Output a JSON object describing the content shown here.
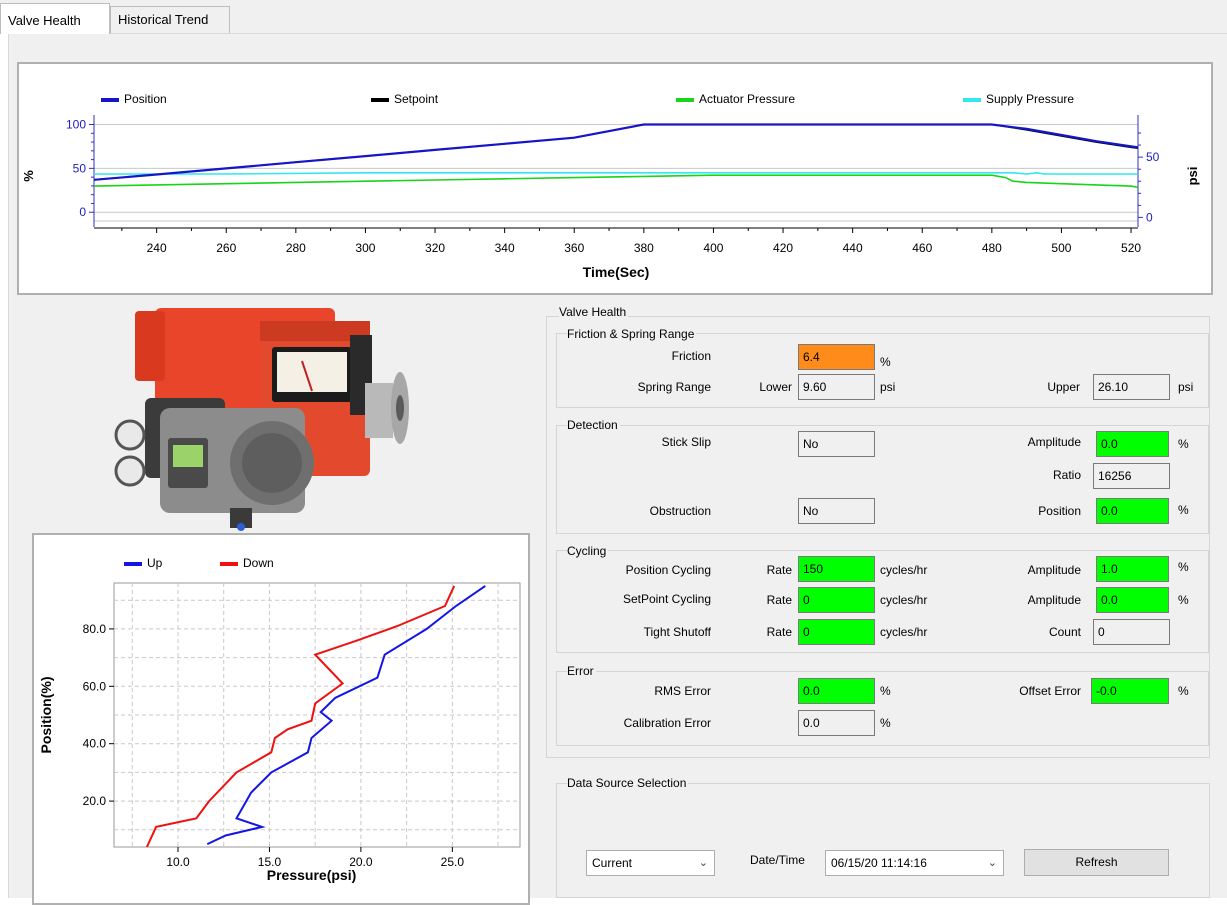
{
  "tabs": [
    {
      "label": "Valve Health",
      "active": true
    },
    {
      "label": "Historical Trend",
      "active": false
    }
  ],
  "trend": {
    "legend": [
      {
        "name": "Position",
        "color": "#1616c8"
      },
      {
        "name": "Setpoint",
        "color": "#000000"
      },
      {
        "name": "Actuator Pressure",
        "color": "#19d419"
      },
      {
        "name": "Supply Pressure",
        "color": "#33e6f0"
      }
    ],
    "ylabel_left": "%",
    "ylabel_right": "psi",
    "xlabel": "Time(Sec)",
    "left_ticks": [
      "100",
      "50",
      "0"
    ],
    "right_ticks": [
      "50",
      "0"
    ],
    "x_ticks": [
      "240",
      "260",
      "280",
      "300",
      "320",
      "340",
      "360",
      "380",
      "400",
      "420",
      "440",
      "460",
      "480",
      "500",
      "520"
    ]
  },
  "pressure_plot": {
    "legend": [
      {
        "name": "Up",
        "color": "#1414e6"
      },
      {
        "name": "Down",
        "color": "#ee1111"
      }
    ],
    "xlabel": "Pressure(psi)",
    "ylabel": "Position(%)",
    "x_ticks": [
      "10.0",
      "15.0",
      "20.0",
      "25.0"
    ],
    "y_ticks": [
      "80.0",
      "60.0",
      "40.0",
      "20.0"
    ]
  },
  "chart_data": [
    {
      "type": "line",
      "xlabel": "Time(Sec)",
      "ylabel": "%",
      "y2label": "psi",
      "xlim": [
        222,
        522
      ],
      "ylim": [
        -10,
        104
      ],
      "y2lim": [
        -3,
        80
      ],
      "grid": true,
      "legend": "top",
      "series": [
        {
          "name": "Position",
          "axis": "left",
          "x": [
            222,
            240,
            260,
            280,
            300,
            320,
            340,
            360,
            380,
            400,
            420,
            440,
            460,
            480,
            490,
            500,
            510,
            520,
            522
          ],
          "y": [
            37,
            43,
            50,
            57,
            64,
            71,
            78,
            85,
            100,
            100,
            100,
            100,
            100,
            100,
            95,
            88,
            81,
            75,
            74
          ]
        },
        {
          "name": "Setpoint",
          "axis": "left",
          "x": [
            222,
            240,
            260,
            280,
            300,
            320,
            340,
            360,
            380,
            400,
            420,
            440,
            460,
            480,
            490,
            500,
            510,
            520,
            522
          ],
          "y": [
            37,
            43,
            50,
            57,
            64,
            71,
            78,
            85,
            100,
            100,
            100,
            100,
            100,
            100,
            94,
            87,
            80,
            74,
            73
          ]
        },
        {
          "name": "Actuator Pressure",
          "axis": "right",
          "x": [
            222,
            240,
            260,
            280,
            300,
            320,
            340,
            360,
            380,
            400,
            420,
            440,
            460,
            480,
            484,
            486,
            490,
            500,
            510,
            520,
            522
          ],
          "y": [
            26,
            27,
            28,
            29,
            30,
            31,
            32,
            33,
            34,
            35,
            35,
            35,
            35,
            35,
            33,
            30,
            29,
            28,
            27,
            26,
            25
          ]
        },
        {
          "name": "Supply Pressure",
          "axis": "right",
          "x": [
            222,
            260,
            300,
            340,
            380,
            420,
            460,
            482,
            486,
            490,
            493,
            495,
            498,
            510,
            522
          ],
          "y": [
            36,
            36,
            37,
            37,
            37,
            37,
            37,
            37,
            37,
            36,
            37,
            36,
            36,
            36,
            36
          ]
        }
      ]
    },
    {
      "type": "line",
      "xlabel": "Pressure(psi)",
      "ylabel": "Position(%)",
      "xlim": [
        6.5,
        28.7
      ],
      "ylim": [
        4,
        96
      ],
      "grid": true,
      "legend": "top",
      "series": [
        {
          "name": "Up",
          "x": [
            11.6,
            12.6,
            14.6,
            13.2,
            14.0,
            15.1,
            17.1,
            17.3,
            18.4,
            17.8,
            18.6,
            20.9,
            21.3,
            23.6,
            25.2,
            26.8
          ],
          "y": [
            5,
            8,
            11,
            14,
            23,
            30,
            37,
            42,
            48,
            51,
            56,
            63,
            71,
            80,
            88,
            95
          ]
        },
        {
          "name": "Down",
          "x": [
            8.3,
            8.8,
            11.0,
            11.7,
            13.2,
            15.1,
            15.3,
            16.0,
            17.3,
            17.5,
            19.0,
            17.5,
            19.8,
            22.0,
            24.6,
            25.1
          ],
          "y": [
            4,
            11,
            14,
            20,
            30,
            37,
            42,
            45,
            48,
            54,
            61,
            71,
            76,
            81,
            88,
            95
          ]
        }
      ]
    }
  ],
  "valve_health": {
    "title": "Valve Health",
    "friction_spring": {
      "title": "Friction & Spring Range",
      "friction_label": "Friction",
      "friction_value": "6.4",
      "friction_unit": "%",
      "spring_label": "Spring Range",
      "lower_label": "Lower",
      "lower_value": "9.60",
      "lower_unit": "psi",
      "upper_label": "Upper",
      "upper_value": "26.10",
      "upper_unit": "psi"
    },
    "detection": {
      "title": "Detection",
      "stick_slip_label": "Stick Slip",
      "stick_slip_value": "No",
      "amplitude_label": "Amplitude",
      "amplitude_value": "0.0",
      "amplitude_unit": "%",
      "ratio_label": "Ratio",
      "ratio_value": "16256",
      "obstruction_label": "Obstruction",
      "obstruction_value": "No",
      "position_label": "Position",
      "position_value": "0.0",
      "position_unit": "%"
    },
    "cycling": {
      "title": "Cycling",
      "rows": [
        {
          "label": "Position Cycling",
          "rate_label": "Rate",
          "rate": "150",
          "rate_unit": "cycles/hr",
          "right_label": "Amplitude",
          "right_value": "1.0",
          "right_unit": "%"
        },
        {
          "label": "SetPoint Cycling",
          "rate_label": "Rate",
          "rate": "0",
          "rate_unit": "cycles/hr",
          "right_label": "Amplitude",
          "right_value": "0.0",
          "right_unit": "%"
        },
        {
          "label": "Tight Shutoff",
          "rate_label": "Rate",
          "rate": "0",
          "rate_unit": "cycles/hr",
          "right_label": "Count",
          "right_value": "0",
          "right_unit": ""
        }
      ]
    },
    "error": {
      "title": "Error",
      "rms_label": "RMS Error",
      "rms_value": "0.0",
      "rms_unit": "%",
      "offset_label": "Offset Error",
      "offset_value": "-0.0",
      "offset_unit": "%",
      "calibration_label": "Calibration Error",
      "calibration_value": "0.0",
      "calibration_unit": "%"
    }
  },
  "data_source": {
    "title": "Data Source Selection",
    "source_value": "Current",
    "datetime_label": "Date/Time",
    "datetime_value": "06/15/20 11:14:16",
    "refresh_label": "Refresh"
  },
  "colors": {
    "green_ok": "#00ff00",
    "orange_warn": "#ff8c1a",
    "valve_red": "#e8452a"
  }
}
